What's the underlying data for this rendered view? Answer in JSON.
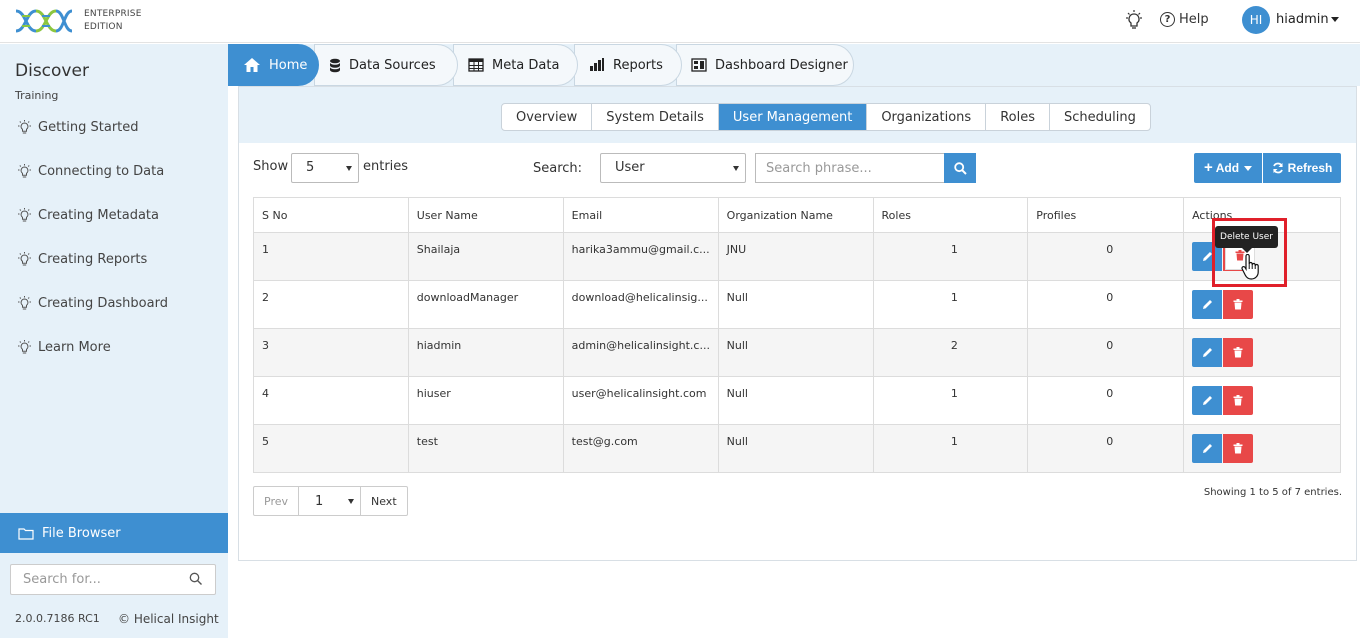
{
  "header": {
    "edition_line1": "ENTERPRISE",
    "edition_line2": "EDITION",
    "help_label": "Help",
    "avatar_initials": "HI",
    "username": "hiadmin",
    "brand_colors": [
      "#3e8fd1",
      "#8cc63f"
    ]
  },
  "sidebar": {
    "title": "Discover",
    "subtitle": "Training",
    "items": [
      {
        "label": "Getting Started",
        "icon": "bulb-icon"
      },
      {
        "label": "Connecting to Data",
        "icon": "bulb-icon"
      },
      {
        "label": "Creating Metadata",
        "icon": "bulb-icon"
      },
      {
        "label": "Creating Reports",
        "icon": "bulb-icon"
      },
      {
        "label": "Creating Dashboard",
        "icon": "bulb-icon"
      },
      {
        "label": "Learn More",
        "icon": "bulb-icon"
      }
    ],
    "file_browser_label": "File Browser",
    "search_placeholder": "Search for...",
    "version": "2.0.0.7186 RC1",
    "copyright": "© Helical Insight"
  },
  "main_tabs": [
    {
      "label": "Home",
      "icon": "home-icon",
      "active": true
    },
    {
      "label": "Data Sources",
      "icon": "database-icon",
      "active": false
    },
    {
      "label": "Meta Data",
      "icon": "table-icon",
      "active": false
    },
    {
      "label": "Reports",
      "icon": "bar-chart-icon",
      "active": false
    },
    {
      "label": "Dashboard Designer",
      "icon": "dashboard-icon",
      "active": false
    }
  ],
  "sub_tabs": [
    {
      "label": "Overview",
      "active": false
    },
    {
      "label": "System Details",
      "active": false
    },
    {
      "label": "User Management",
      "active": true
    },
    {
      "label": "Organizations",
      "active": false
    },
    {
      "label": "Roles",
      "active": false
    },
    {
      "label": "Scheduling",
      "active": false
    }
  ],
  "controls": {
    "show_label": "Show",
    "entries_value": "5",
    "entries_label": "entries",
    "search_label": "Search:",
    "search_field_value": "User",
    "search_placeholder": "Search phrase...",
    "add_label": "Add",
    "refresh_label": "Refresh"
  },
  "table": {
    "headers": [
      "S No",
      "User Name",
      "Email",
      "Organization Name",
      "Roles",
      "Profiles",
      "Actions"
    ],
    "rows": [
      {
        "sno": "1",
        "user": "Shailaja",
        "email": "harika3ammu@gmail.c...",
        "org": "JNU",
        "roles": "1",
        "profiles": "0"
      },
      {
        "sno": "2",
        "user": "downloadManager",
        "email": "download@helicalinsig...",
        "org": "Null",
        "roles": "1",
        "profiles": "0"
      },
      {
        "sno": "3",
        "user": "hiadmin",
        "email": "admin@helicalinsight.c...",
        "org": "Null",
        "roles": "2",
        "profiles": "0"
      },
      {
        "sno": "4",
        "user": "hiuser",
        "email": "user@helicalinsight.com",
        "org": "Null",
        "roles": "1",
        "profiles": "0"
      },
      {
        "sno": "5",
        "user": "test",
        "email": "test@g.com",
        "org": "Null",
        "roles": "1",
        "profiles": "0"
      }
    ]
  },
  "pagination": {
    "prev_label": "Prev",
    "page_value": "1",
    "next_label": "Next",
    "showing_text": "Showing 1 to 5 of 7 entries."
  },
  "tooltip": {
    "text": "Delete User"
  }
}
